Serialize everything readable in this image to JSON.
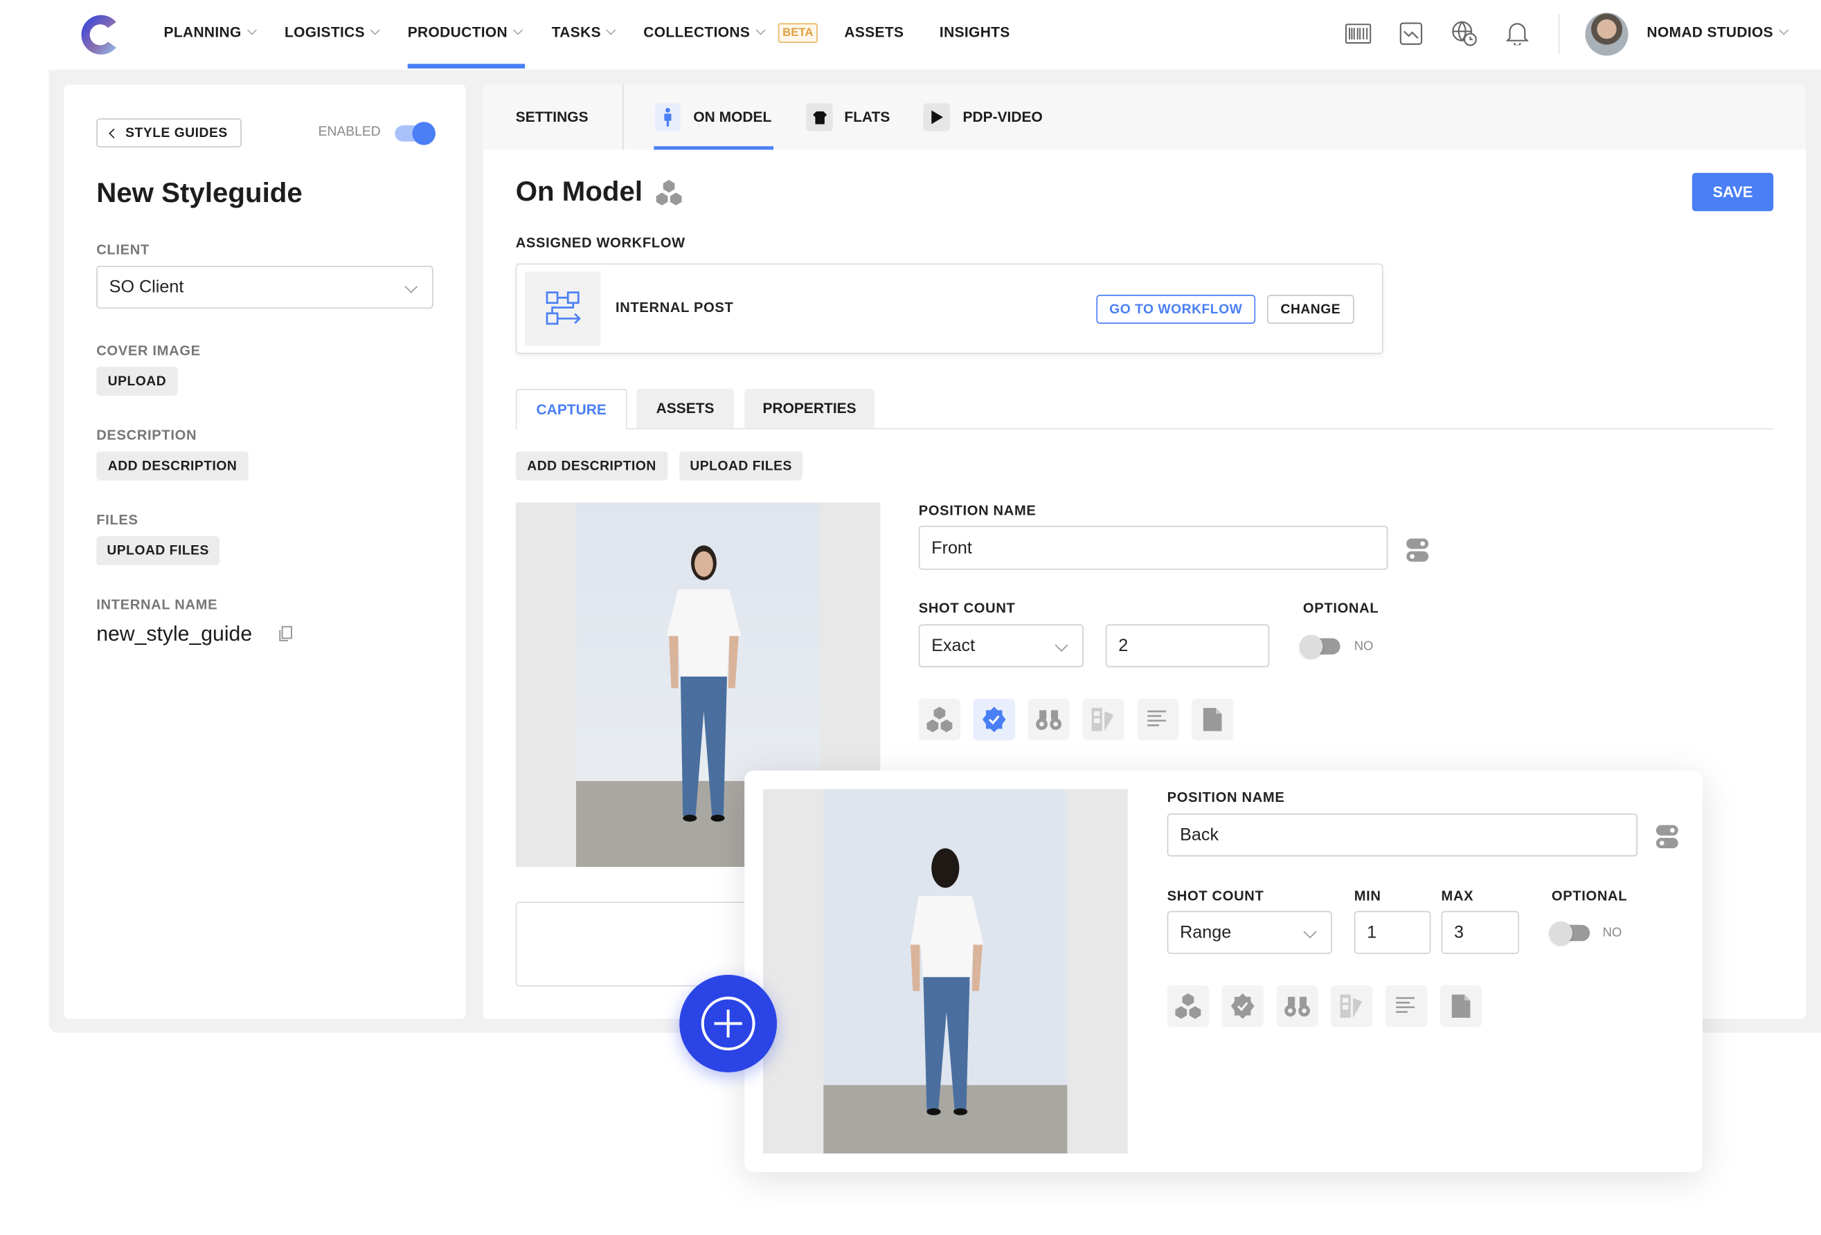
{
  "nav": {
    "items": [
      {
        "label": "PLANNING",
        "dropdown": true
      },
      {
        "label": "LOGISTICS",
        "dropdown": true
      },
      {
        "label": "PRODUCTION",
        "dropdown": true,
        "active": true
      },
      {
        "label": "TASKS",
        "dropdown": true
      },
      {
        "label": "COLLECTIONS",
        "dropdown": true
      },
      {
        "label": "ASSETS"
      },
      {
        "label": "INSIGHTS"
      }
    ],
    "beta_badge": "BETA",
    "account": "NOMAD STUDIOS",
    "accent": "#4a7ff5"
  },
  "sidebar": {
    "back_label": "STYLE GUIDES",
    "enabled_label": "ENABLED",
    "enabled": true,
    "title": "New Styleguide",
    "client_label": "CLIENT",
    "client_value": "SO Client",
    "cover_label": "COVER IMAGE",
    "upload_label": "UPLOAD",
    "description_label": "DESCRIPTION",
    "add_description_label": "ADD DESCRIPTION",
    "files_label": "FILES",
    "upload_files_label": "UPLOAD FILES",
    "internal_name_label": "INTERNAL NAME",
    "internal_name": "new_style_guide"
  },
  "tabs": {
    "settings": "SETTINGS",
    "on_model": "ON MODEL",
    "flats": "FLATS",
    "pdp_video": "PDP-VIDEO"
  },
  "main": {
    "title": "On Model",
    "save": "SAVE",
    "workflow_label": "ASSIGNED WORKFLOW",
    "workflow_name": "INTERNAL POST",
    "go_to_workflow": "GO TO WORKFLOW",
    "change": "CHANGE",
    "subtabs": [
      "CAPTURE",
      "ASSETS",
      "PROPERTIES"
    ],
    "add_description": "ADD DESCRIPTION",
    "upload_files": "UPLOAD FILES"
  },
  "positions": [
    {
      "position_label": "POSITION NAME",
      "name": "Front",
      "shot_label": "SHOT COUNT",
      "shot_type": "Exact",
      "count": "2",
      "optional_label": "OPTIONAL",
      "optional_value": "NO"
    },
    {
      "position_label": "POSITION NAME",
      "name": "Back",
      "shot_label": "SHOT COUNT",
      "shot_type": "Range",
      "min_label": "MIN",
      "min": "1",
      "max_label": "MAX",
      "max": "3",
      "optional_label": "OPTIONAL",
      "optional_value": "NO"
    }
  ]
}
